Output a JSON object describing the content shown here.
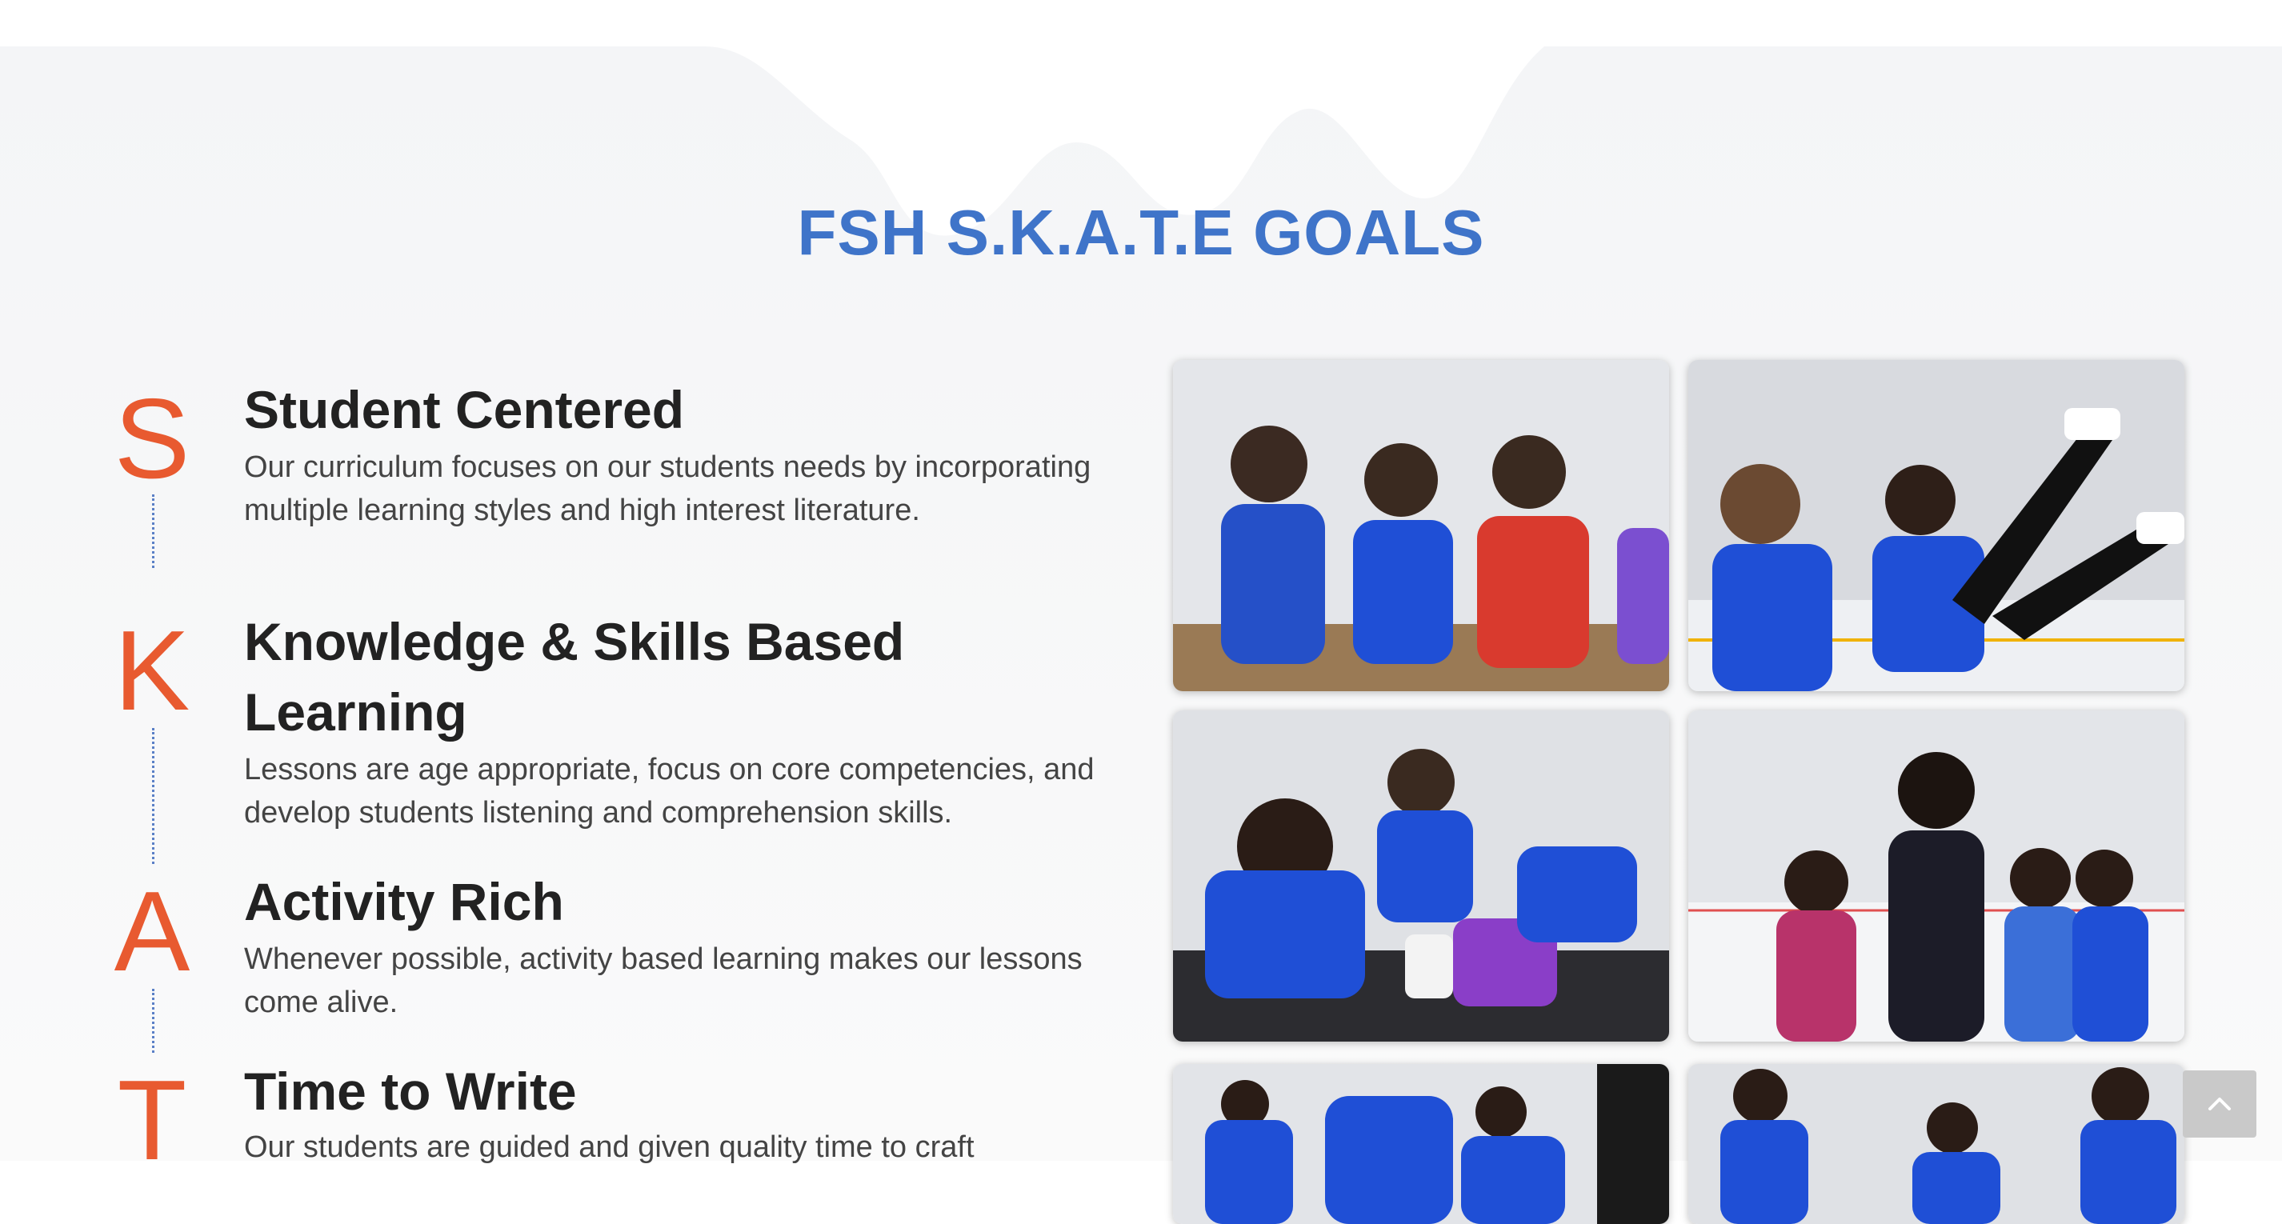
{
  "section": {
    "title": "FSH S.K.A.T.E GOALS"
  },
  "goals": [
    {
      "letter": "S",
      "heading": "Student Centered",
      "text": "Our curriculum focuses on our students needs by incorporating multiple learning styles and high interest literature."
    },
    {
      "letter": "K",
      "heading": "Knowledge & Skills Based Learning",
      "text": "Lessons are age appropriate, focus on core competencies, and develop students listening and comprehension skills."
    },
    {
      "letter": "A",
      "heading": "Activity Rich",
      "text": "Whenever possible, activity based learning makes our lessons come alive."
    },
    {
      "letter": "T",
      "heading": "Time to Write",
      "text": "Our students are guided and given quality time to craft"
    }
  ],
  "colors": {
    "title": "#3f74c9",
    "letters": "#e85a30",
    "shirts": "#1f4fd6"
  },
  "icons": {
    "back_to_top": "chevron-up-icon"
  }
}
